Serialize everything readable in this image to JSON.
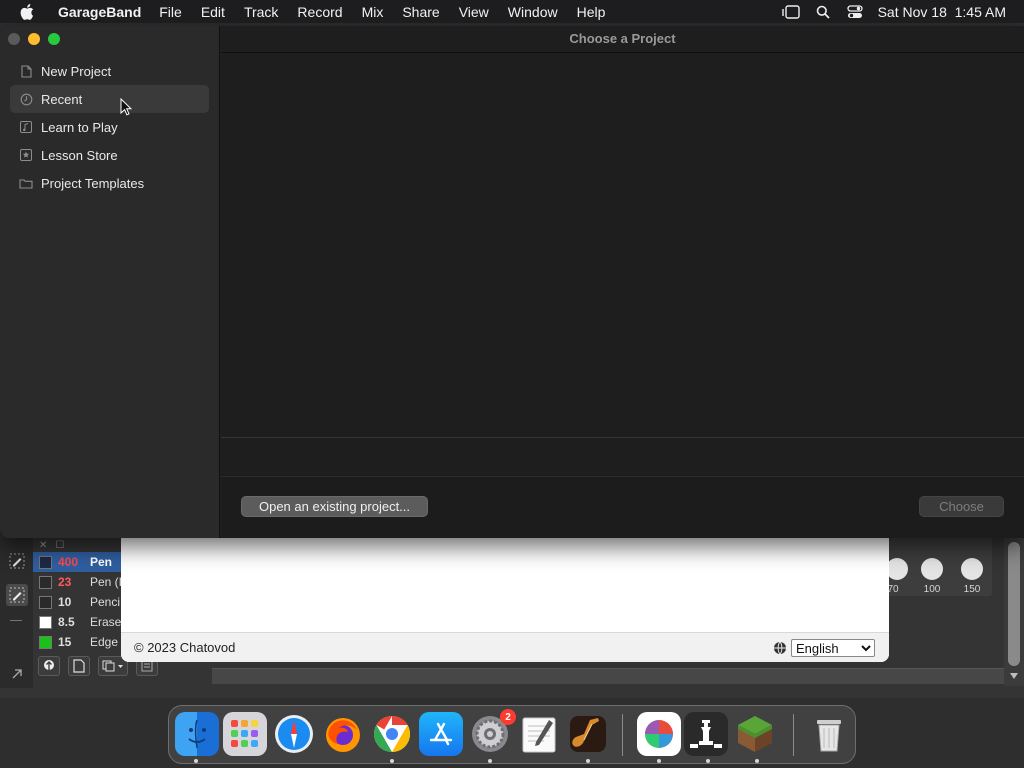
{
  "menubar": {
    "app_name": "GarageBand",
    "menus": [
      "File",
      "Edit",
      "Track",
      "Record",
      "Mix",
      "Share",
      "View",
      "Window",
      "Help"
    ],
    "datetime": "Sat Nov 18  1:45 AM"
  },
  "dialog": {
    "title": "Choose a Project",
    "sidebar": [
      {
        "label": "New Project",
        "icon": "document-icon"
      },
      {
        "label": "Recent",
        "icon": "clock-icon",
        "selected": true
      },
      {
        "label": "Learn to Play",
        "icon": "music-note-icon"
      },
      {
        "label": "Lesson Store",
        "icon": "star-icon"
      },
      {
        "label": "Project Templates",
        "icon": "folder-icon"
      }
    ],
    "open_button": "Open an existing project...",
    "choose_button": "Choose"
  },
  "background_app": {
    "layers": [
      {
        "value": "400",
        "name": "Pen",
        "swatch": "#1b2a44"
      },
      {
        "value": "23",
        "name": "Pen (I",
        "swatch": "#2a2a2a"
      },
      {
        "value": "10",
        "name": "Penci",
        "swatch": "#2a2a2a"
      },
      {
        "value": "8.5",
        "name": "Erase",
        "swatch": "#ffffff"
      },
      {
        "value": "15",
        "name": "Edge",
        "swatch": "#19c219"
      }
    ],
    "knobs": [
      "70",
      "100",
      "150"
    ]
  },
  "webpage": {
    "copyright": "© 2023 Chatovod",
    "language": "English"
  },
  "dock": {
    "apps": [
      {
        "name": "finder-icon"
      },
      {
        "name": "launchpad-icon"
      },
      {
        "name": "safari-icon"
      },
      {
        "name": "firefox-icon"
      },
      {
        "name": "chrome-icon"
      },
      {
        "name": "app-store-icon"
      },
      {
        "name": "system-settings-icon",
        "badge": "2"
      },
      {
        "name": "textedit-icon"
      },
      {
        "name": "garageband-icon"
      },
      {
        "name": "color-app-icon"
      },
      {
        "name": "chess-icon"
      },
      {
        "name": "minecraft-icon"
      },
      {
        "name": "trash-icon"
      }
    ]
  },
  "colors": {
    "close": "#5a5a5a",
    "minimize": "#febc2e",
    "zoom": "#28c840",
    "selection": "#3a3a3a"
  }
}
